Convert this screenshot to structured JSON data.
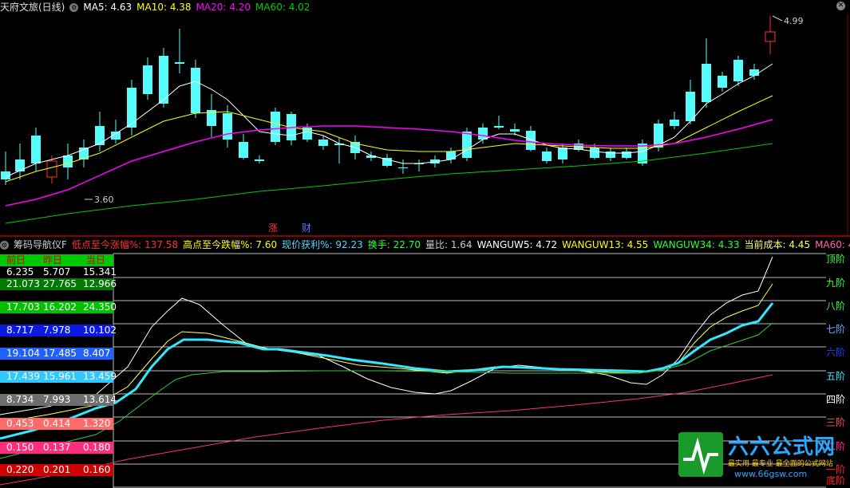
{
  "top_header": {
    "title": "天府文旅(日线)",
    "ma5": "MA5: 4.63",
    "ma10": "MA10: 4.38",
    "ma20": "MA20: 4.20",
    "ma60": "MA60: 4.02"
  },
  "price_labels": {
    "high": "4.99",
    "low": "3.60"
  },
  "markers": {
    "zhang": "涨",
    "cai": "财"
  },
  "bottom_header": {
    "name": "筹码导航仪F",
    "low_rise": "低点至今涨幅%: 137.58",
    "high_fall": "高点至今跌幅%: 7.60",
    "profit": "现价获利%: 92.23",
    "turnover": "换手: 22.70",
    "volratio": "量比: 1.64",
    "w5": "WANGUW5: 4.72",
    "w13": "WANGUW13: 4.55",
    "w34": "WANGUW34: 4.33",
    "cost": "当前成本: 4.45",
    "ma60": "MA60: 4.02"
  },
  "table": {
    "headers": [
      "前日",
      "昨日",
      "当日"
    ],
    "rows": [
      [
        "6.235",
        "5.707",
        "15.341"
      ],
      [
        "21.073",
        "27.765",
        "12.966"
      ],
      [
        "17.703",
        "16.202",
        "24.350"
      ],
      [
        "8.717",
        "7.978",
        "10.102"
      ],
      [
        "19.104",
        "17.485",
        "8.407"
      ],
      [
        "17.439",
        "15.961",
        "13.459"
      ],
      [
        "8.734",
        "7.993",
        "13.614"
      ],
      [
        "0.453",
        "0.414",
        "1.320"
      ],
      [
        "0.150",
        "0.137",
        "0.180"
      ],
      [
        "0.220",
        "0.201",
        "0.160"
      ]
    ]
  },
  "levels": [
    "顶阶",
    "九阶",
    "八阶",
    "七阶",
    "六阶",
    "五阶",
    "四阶",
    "三阶",
    "二阶",
    "一阶",
    "底阶"
  ],
  "colors": {
    "up": "#ff3232",
    "down": "#54fcfc",
    "ma5": "#ffffff",
    "ma10": "#ffff00",
    "ma20": "#ff00ff",
    "ma60": "#00cc00"
  },
  "watermark": {
    "title": "六六公式网",
    "subtitle": "最实用 最专业 最全面的公式网站",
    "url": "www.66gsw.com"
  }
}
